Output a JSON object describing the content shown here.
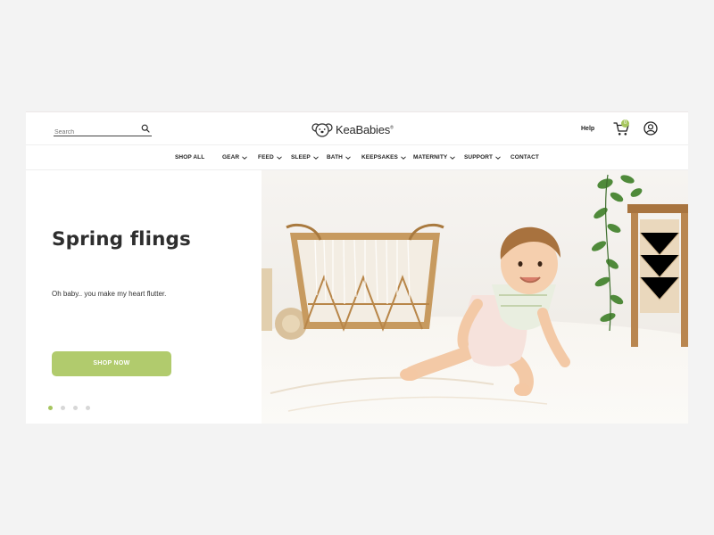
{
  "header": {
    "search": {
      "placeholder": "Search",
      "value": ""
    },
    "brand": "KeaBabies",
    "brand_mark": "®",
    "help_label": "Help",
    "cart_count": "0"
  },
  "nav": {
    "items": [
      {
        "label": "SHOP ALL",
        "dropdown": false
      },
      {
        "label": "GEAR",
        "dropdown": true
      },
      {
        "label": "FEED",
        "dropdown": true
      },
      {
        "label": "SLEEP",
        "dropdown": true
      },
      {
        "label": "BATH",
        "dropdown": true
      },
      {
        "label": "KEEPSAKES",
        "dropdown": true
      },
      {
        "label": "MATERNITY",
        "dropdown": true
      },
      {
        "label": "SUPPORT",
        "dropdown": true
      },
      {
        "label": "CONTACT",
        "dropdown": false
      }
    ]
  },
  "hero": {
    "title": "Spring flings",
    "subtitle": "Oh baby.. you make my heart flutter.",
    "cta_label": "SHOP NOW",
    "slides_total": 4,
    "active_slide": 1
  },
  "colors": {
    "accent": "#b1cb6d",
    "badge": "#a6c55f",
    "background": "#f3f3f3",
    "text": "#2e2e2e"
  },
  "icons": [
    "search-icon",
    "koala-logo-icon",
    "cart-icon",
    "account-icon",
    "chevron-down-icon"
  ]
}
